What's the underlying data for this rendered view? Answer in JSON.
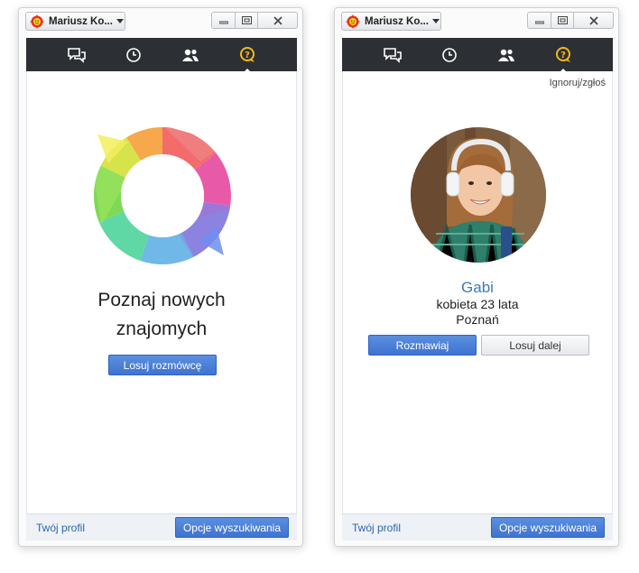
{
  "left": {
    "user_name": "Mariusz Ko...",
    "headline_line1": "Poznaj nowych",
    "headline_line2": "znajomych",
    "draw_button": "Losuj rozmówcę",
    "profile_link": "Twój profil",
    "search_options": "Opcje wyszukiwania"
  },
  "right": {
    "user_name": "Mariusz Ko...",
    "ignore_link": "Ignoruj/zgłoś",
    "name": "Gabi",
    "details": "kobieta 23 lata",
    "city": "Poznań",
    "chat_button": "Rozmawiaj",
    "next_button": "Losuj dalej",
    "profile_link": "Twój profil",
    "search_options": "Opcje wyszukiwania"
  },
  "nav_icons": [
    "chat-bubbles-icon",
    "clock-icon",
    "contacts-icon",
    "random-chat-icon"
  ],
  "colors": {
    "nav_bg": "#2c2f33",
    "active_icon": "#f5b81c",
    "accent_blue": "#3f73d0",
    "name_blue": "#3a7bb5"
  }
}
